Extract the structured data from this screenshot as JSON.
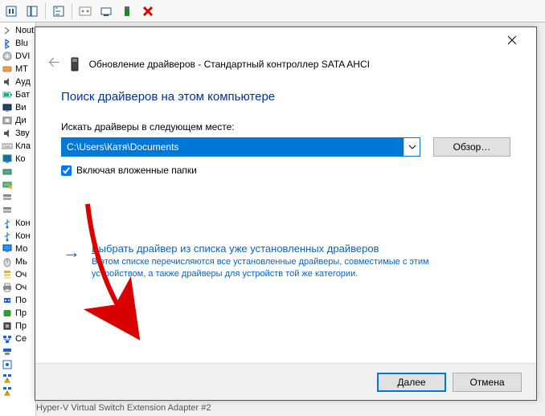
{
  "toolbar": {
    "items": [
      "slider",
      "columns",
      "tree",
      "hidden",
      "chart",
      "additem",
      "delete"
    ]
  },
  "devices": [
    {
      "icon": "chevron",
      "label": "Nout"
    },
    {
      "icon": "bluetooth",
      "label": "Blu"
    },
    {
      "icon": "disc",
      "label": "DVI"
    },
    {
      "icon": "hid",
      "label": "MT"
    },
    {
      "icon": "audio",
      "label": "Ауд"
    },
    {
      "icon": "battery",
      "label": "Бат"
    },
    {
      "icon": "video",
      "label": "Ви"
    },
    {
      "icon": "disk",
      "label": "Ди"
    },
    {
      "icon": "audio",
      "label": "Зву"
    },
    {
      "icon": "keyboard",
      "label": "Кла"
    },
    {
      "icon": "computer",
      "label": "Ко"
    },
    {
      "icon": "ide",
      "label": ""
    },
    {
      "icon": "ide-dev",
      "label": ""
    },
    {
      "icon": "storage",
      "label": ""
    },
    {
      "icon": "storage",
      "label": ""
    },
    {
      "icon": "usb",
      "label": "Кон"
    },
    {
      "icon": "usb",
      "label": "Кон"
    },
    {
      "icon": "monitor",
      "label": "Мо"
    },
    {
      "icon": "mouse",
      "label": "Мь"
    },
    {
      "icon": "queue",
      "label": "Оч"
    },
    {
      "icon": "printer",
      "label": "Оч"
    },
    {
      "icon": "port",
      "label": "По"
    },
    {
      "icon": "firmware",
      "label": "Пр"
    },
    {
      "icon": "cpu",
      "label": "Пр"
    },
    {
      "icon": "network",
      "label": "Се"
    },
    {
      "icon": "network2",
      "label": ""
    },
    {
      "icon": "network3",
      "label": ""
    },
    {
      "icon": "warn-net",
      "label": ""
    },
    {
      "icon": "warn-net",
      "label": ""
    }
  ],
  "bottom_adapter": "Hyper-V Virtual Switch Extension Adapter #2",
  "dialog": {
    "back": "←",
    "title": "Обновление драйверов - Стандартный контроллер SATA AHCI",
    "heading": "Поиск драйверов на этом компьютере",
    "path_label": "Искать драйверы в следующем месте:",
    "path_value": "C:\\Users\\Катя\\Documents",
    "browse": "Обзор…",
    "include_sub": "Включая вложенные папки",
    "link_title_prefix": "В",
    "link_title_rest": "ыбрать драйвер из списка уже установленных драйверов",
    "link_desc": "В этом списке перечисляются все установленные драйверы, совместимые с этим устройством, а также драйверы для устройств той же категории.",
    "next_prefix": "Д",
    "next_rest": "алее",
    "cancel": "Отмена"
  }
}
